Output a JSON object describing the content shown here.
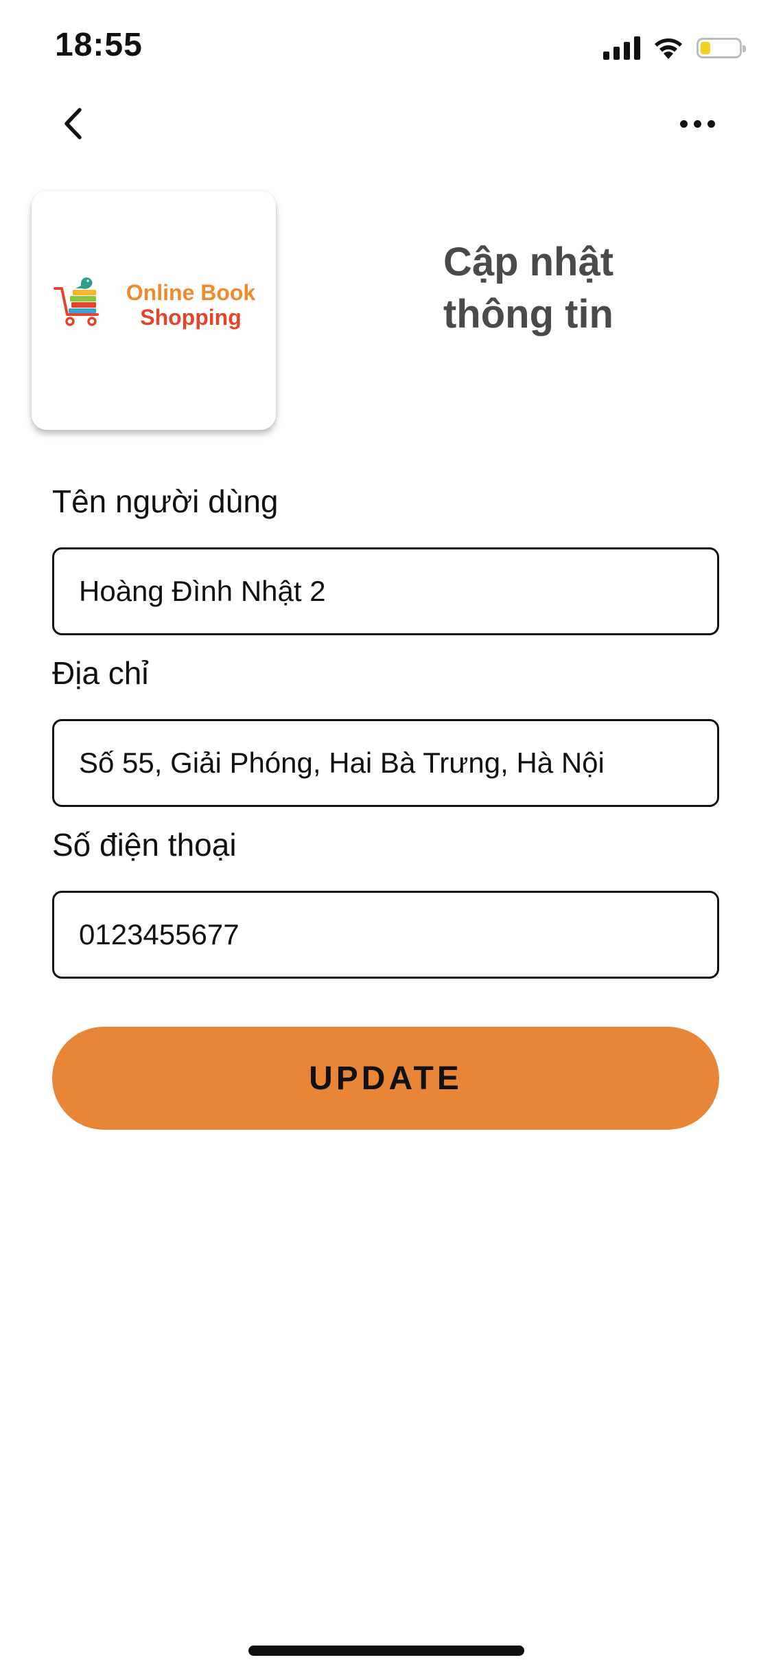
{
  "status_bar": {
    "time": "18:55",
    "battery_fraction": 0.25,
    "icons": [
      "signal-icon",
      "wifi-icon",
      "battery-icon"
    ]
  },
  "nav": {
    "back_icon": "chevron-left-icon",
    "more_icon": "more-horizontal-icon"
  },
  "header": {
    "logo": {
      "line1": "Online Book",
      "line2": "Shopping"
    },
    "title_line1": "Cập nhật",
    "title_line2": "thông tin"
  },
  "form": {
    "username": {
      "label": "Tên người dùng",
      "value": "Hoàng Đình Nhật 2"
    },
    "address": {
      "label": "Địa chỉ",
      "value": "Số 55, Giải Phóng, Hai Bà Trưng, Hà Nội"
    },
    "phone": {
      "label": "Số điện thoại",
      "value": "0123455677"
    },
    "submit_label": "UPDATE"
  },
  "colors": {
    "accent": "#e88536",
    "title": "#4a4a4a",
    "logo_orange": "#f08a2e",
    "logo_red": "#e3452a",
    "battery_level": "#f5d21b"
  }
}
